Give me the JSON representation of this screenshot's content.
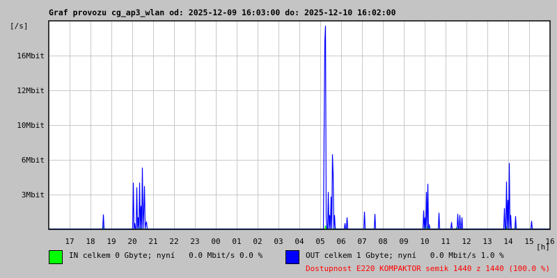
{
  "chart_data": {
    "type": "line",
    "title": "Graf provozu cg_ap3_wlan od: 2025-12-09 16:03:00 do: 2025-12-10 16:02:00",
    "ylabel": "[/s]",
    "xlabel": "[h]",
    "x_unit": "hours since 16:03",
    "xlim": [
      0,
      24
    ],
    "y_ticks": [
      {
        "label": "3Mbit",
        "value": 3
      },
      {
        "label": "6Mbit",
        "value": 6
      },
      {
        "label": "10Mbit",
        "value": 10
      },
      {
        "label": "12Mbit",
        "value": 12
      },
      {
        "label": "16Mbit",
        "value": 16
      }
    ],
    "x_ticks": [
      "17",
      "18",
      "19",
      "20",
      "21",
      "22",
      "23",
      "00",
      "01",
      "02",
      "03",
      "04",
      "05",
      "06",
      "07",
      "08",
      "09",
      "10",
      "11",
      "12",
      "13",
      "14",
      "15",
      "16"
    ],
    "grid": true,
    "colors": {
      "in": "#00ff00",
      "out": "#0000ff",
      "grid": "#c8c8c8",
      "availability": "#ff0000"
    },
    "series": [
      {
        "name": "IN",
        "points": [
          [
            2.6,
            0.2
          ],
          [
            4.35,
            0.15
          ],
          [
            13.23,
            0.3
          ],
          [
            13.7,
            0.1
          ],
          [
            18.0,
            0.2
          ],
          [
            18.13,
            0.15
          ],
          [
            19.5,
            0.1
          ],
          [
            21.9,
            0.15
          ],
          [
            22.33,
            0.3
          ]
        ]
      },
      {
        "name": "OUT",
        "points": [
          [
            2.6,
            1.26
          ],
          [
            4.03,
            4.0
          ],
          [
            4.1,
            0.5
          ],
          [
            4.2,
            3.6
          ],
          [
            4.27,
            1.0
          ],
          [
            4.33,
            4.0
          ],
          [
            4.4,
            2.0
          ],
          [
            4.47,
            5.3
          ],
          [
            4.53,
            1.5
          ],
          [
            4.57,
            3.7
          ],
          [
            4.63,
            0.5
          ],
          [
            4.67,
            0.6
          ],
          [
            13.17,
            9.2
          ],
          [
            13.2,
            17.5
          ],
          [
            13.23,
            19.4
          ],
          [
            13.27,
            1.0
          ],
          [
            13.37,
            3.2
          ],
          [
            13.43,
            1.2
          ],
          [
            13.5,
            2.8
          ],
          [
            13.57,
            6.6
          ],
          [
            13.6,
            4.7
          ],
          [
            13.67,
            1.2
          ],
          [
            14.17,
            0.5
          ],
          [
            14.27,
            1.0
          ],
          [
            15.1,
            1.5
          ],
          [
            15.6,
            1.3
          ],
          [
            17.93,
            1.6
          ],
          [
            18.0,
            1.0
          ],
          [
            18.07,
            3.2
          ],
          [
            18.13,
            3.9
          ],
          [
            18.2,
            0.4
          ],
          [
            18.67,
            1.4
          ],
          [
            19.27,
            0.6
          ],
          [
            19.57,
            1.3
          ],
          [
            19.67,
            1.2
          ],
          [
            19.77,
            1.0
          ],
          [
            21.8,
            1.8
          ],
          [
            21.9,
            4.1
          ],
          [
            21.97,
            2.5
          ],
          [
            22.03,
            5.7
          ],
          [
            22.1,
            1.2
          ],
          [
            22.33,
            1.1
          ],
          [
            23.1,
            0.7
          ]
        ]
      }
    ]
  },
  "legend": {
    "in_text": "IN celkem 0 Gbyte; nyní   0.0 Mbit/s 0.0 %",
    "out_text": "OUT celkem 1 Gbyte; nyní   0.0 Mbit/s 1.0 %",
    "availability": "Dostupnost E220 KOMPAKTOR semik 1440 z 1440 (100.0 %)"
  }
}
